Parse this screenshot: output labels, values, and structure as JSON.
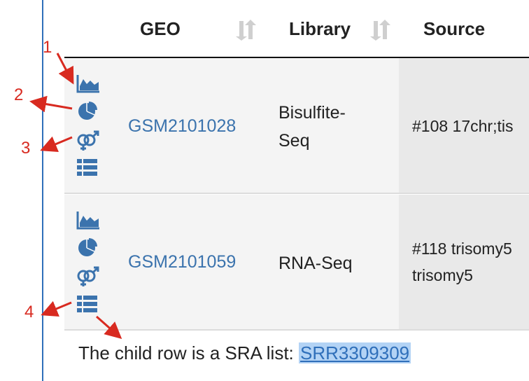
{
  "table": {
    "headers": {
      "geo": "GEO",
      "library": "Library",
      "source": "Source"
    },
    "rows": [
      {
        "geo": "GSM2101028",
        "library_line1": "Bisulfite-",
        "library_line2": "Seq",
        "source_line1": "#108 17chr;tis",
        "source_line2": ""
      },
      {
        "geo": "GSM2101059",
        "library_line1": "RNA-Seq",
        "library_line2": "",
        "source_line1": "#118 trisomy5",
        "source_line2": "trisomy5"
      }
    ]
  },
  "annotations": {
    "n1": "1",
    "n2": "2",
    "n3": "3",
    "n4": "4"
  },
  "caption": {
    "text": "The child row is a SRA list: ",
    "link": "SRR3309309"
  },
  "icons": [
    "area-chart-icon",
    "pie-chart-icon",
    "gender-icon",
    "list-icon"
  ],
  "colors": {
    "icon": "#3b73ad",
    "annotation": "#d82a20",
    "link": "#3b73ad",
    "selection": "#b3d3f5"
  }
}
